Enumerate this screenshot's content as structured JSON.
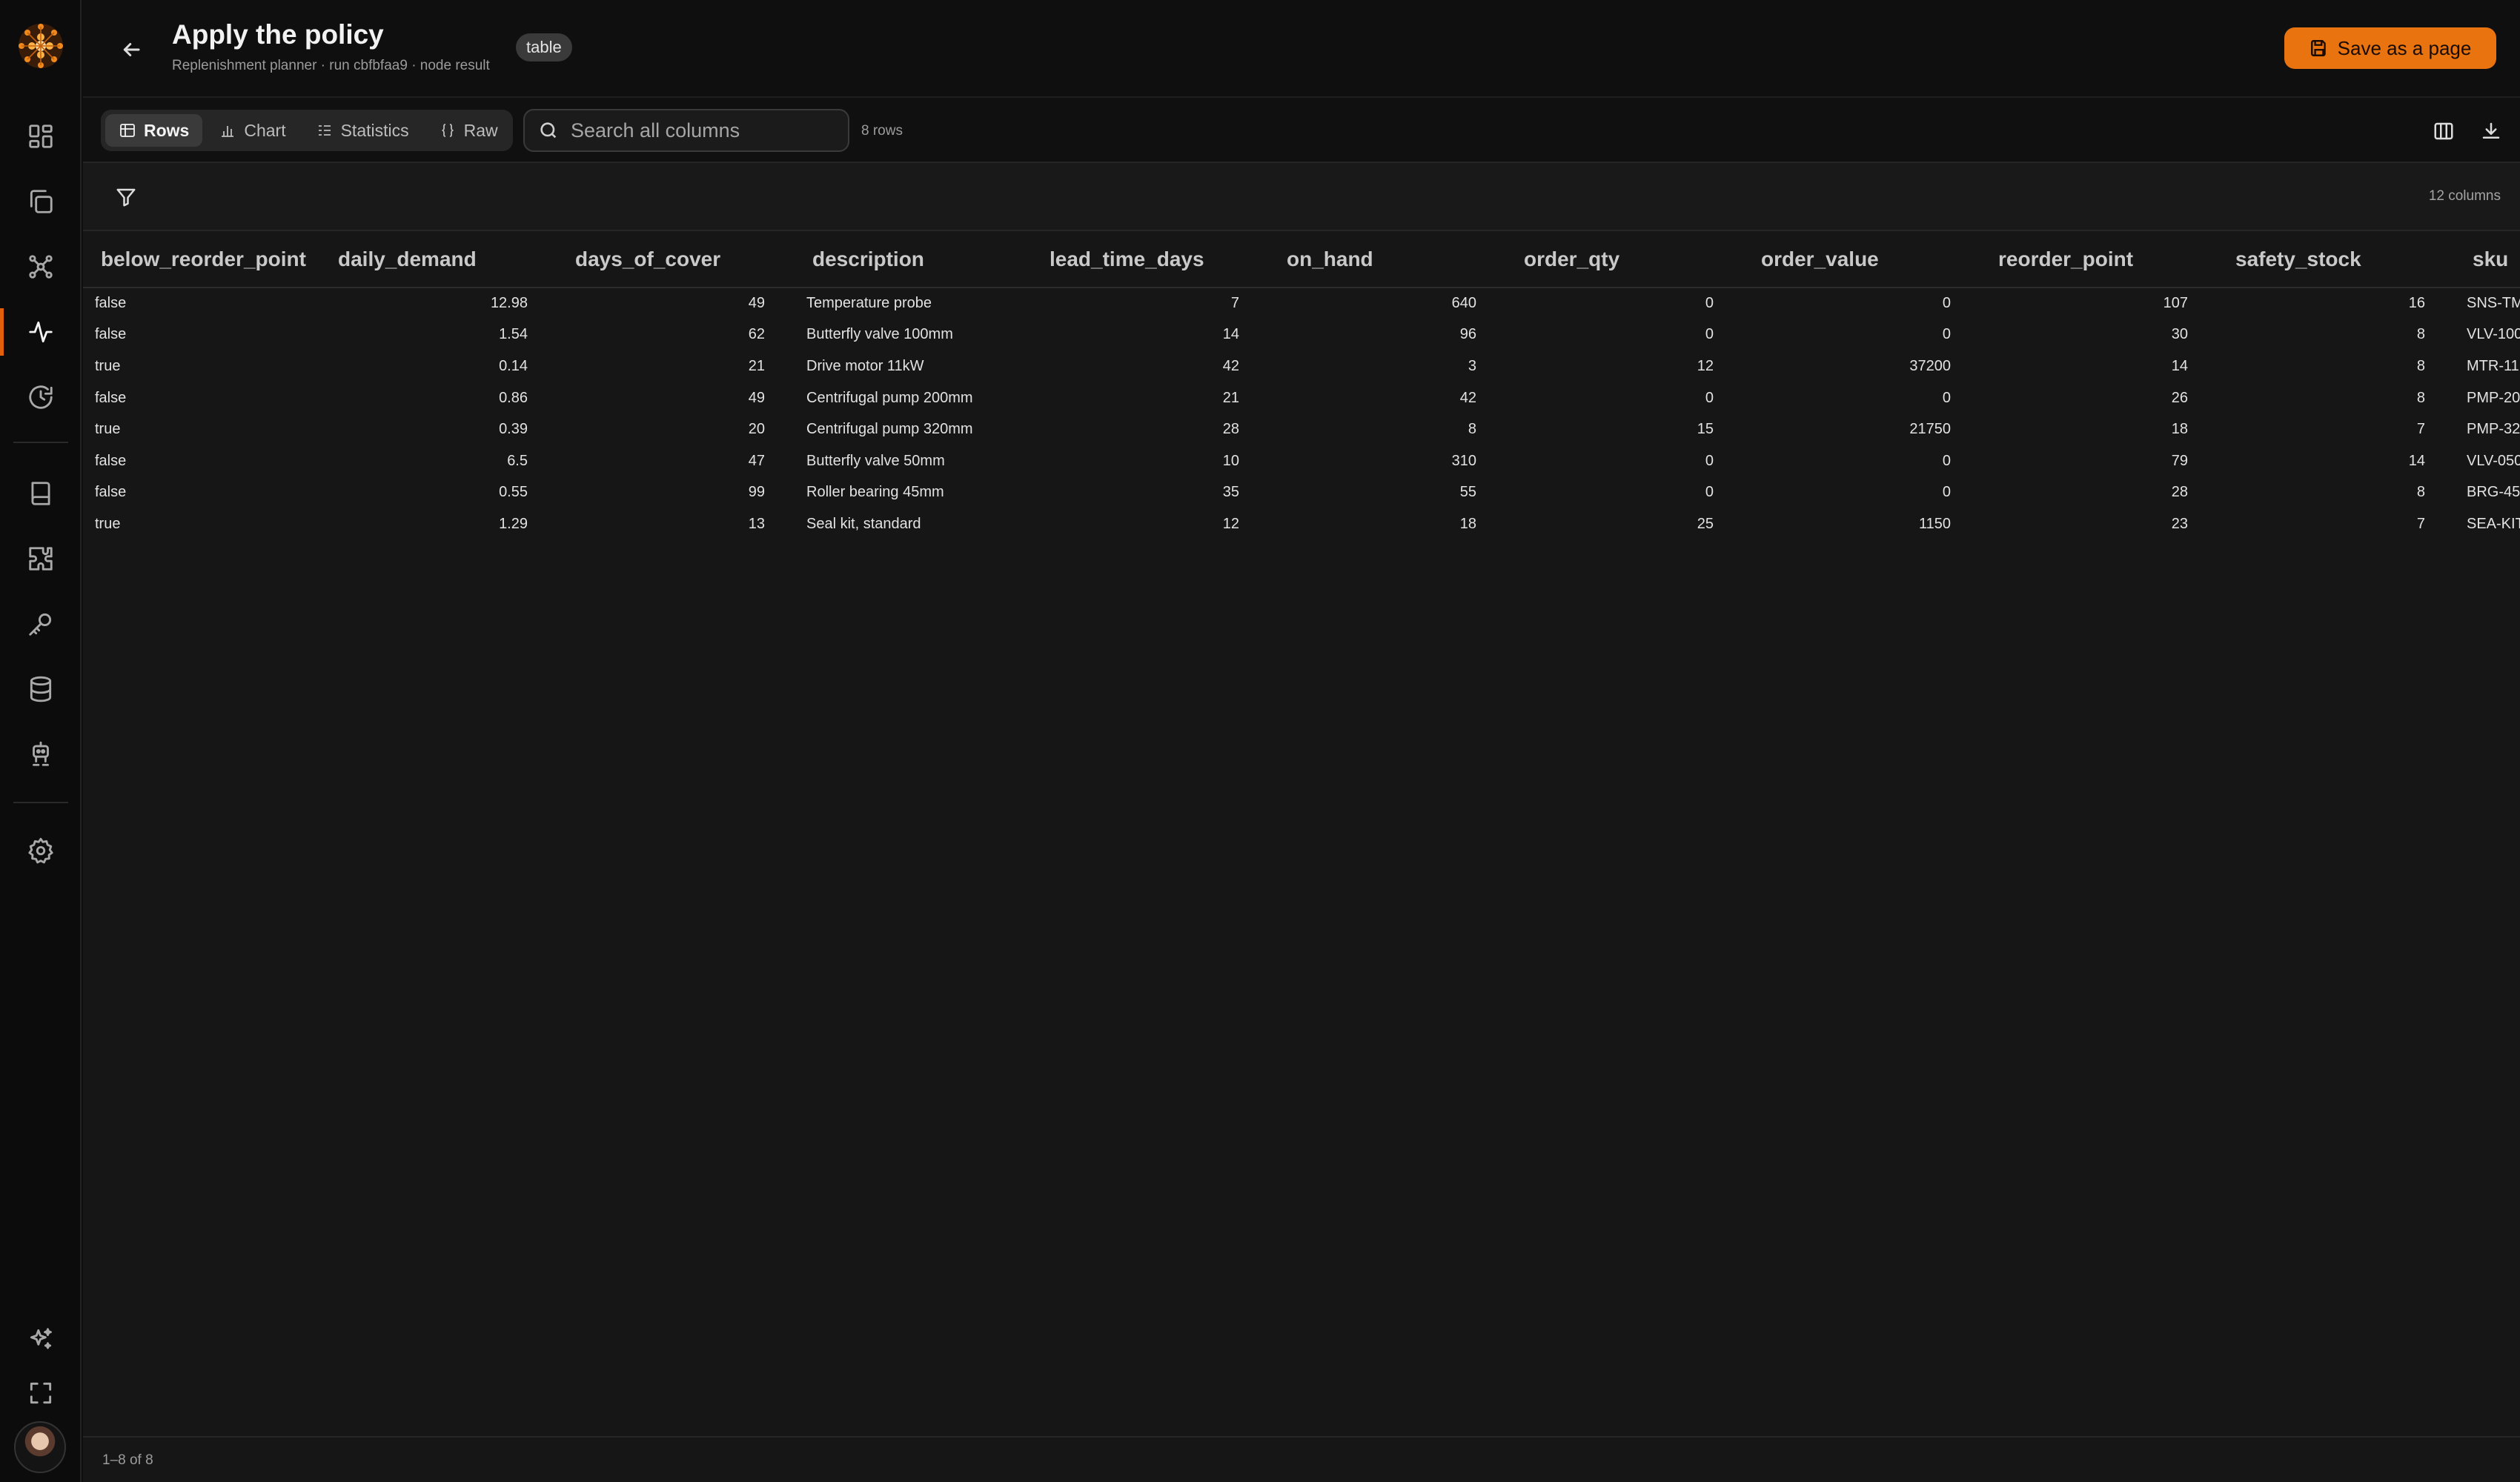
{
  "header": {
    "title": "Apply the policy",
    "subtitle": "Replenishment planner · run cbfbfaa9 · node result",
    "badge": "table",
    "save_label": "Save as a page"
  },
  "toolbar": {
    "tabs": [
      {
        "label": "Rows",
        "icon": "table-icon"
      },
      {
        "label": "Chart",
        "icon": "bar-chart-icon"
      },
      {
        "label": "Statistics",
        "icon": "list-icon"
      },
      {
        "label": "Raw",
        "icon": "braces-icon"
      }
    ],
    "search_placeholder": "Search all columns",
    "row_count": "8 rows"
  },
  "filterbar": {
    "column_count": "12 columns"
  },
  "colors": {
    "accent": "#e8730f",
    "background": "#0f0f0f",
    "table_bg": "#161616"
  },
  "table": {
    "columns": [
      "below_reorder_point",
      "daily_demand",
      "days_of_cover",
      "description",
      "lead_time_days",
      "on_hand",
      "order_qty",
      "order_value",
      "reorder_point",
      "safety_stock",
      "sku"
    ],
    "rows": [
      [
        "false",
        "12.98",
        "49",
        "Temperature probe",
        "7",
        "640",
        "0",
        "0",
        "107",
        "16",
        "SNS-TM"
      ],
      [
        "false",
        "1.54",
        "62",
        "Butterfly valve 100mm",
        "14",
        "96",
        "0",
        "0",
        "30",
        "8",
        "VLV-100"
      ],
      [
        "true",
        "0.14",
        "21",
        "Drive motor 11kW",
        "42",
        "3",
        "12",
        "37200",
        "14",
        "8",
        "MTR-11"
      ],
      [
        "false",
        "0.86",
        "49",
        "Centrifugal pump 200mm",
        "21",
        "42",
        "0",
        "0",
        "26",
        "8",
        "PMP-20"
      ],
      [
        "true",
        "0.39",
        "20",
        "Centrifugal pump 320mm",
        "28",
        "8",
        "15",
        "21750",
        "18",
        "7",
        "PMP-32"
      ],
      [
        "false",
        "6.5",
        "47",
        "Butterfly valve 50mm",
        "10",
        "310",
        "0",
        "0",
        "79",
        "14",
        "VLV-050"
      ],
      [
        "false",
        "0.55",
        "99",
        "Roller bearing 45mm",
        "35",
        "55",
        "0",
        "0",
        "28",
        "8",
        "BRG-45"
      ],
      [
        "true",
        "1.29",
        "13",
        "Seal kit, standard",
        "12",
        "18",
        "25",
        "1150",
        "23",
        "7",
        "SEA-KIT"
      ]
    ]
  },
  "footer": {
    "range": "1–8 of 8"
  }
}
